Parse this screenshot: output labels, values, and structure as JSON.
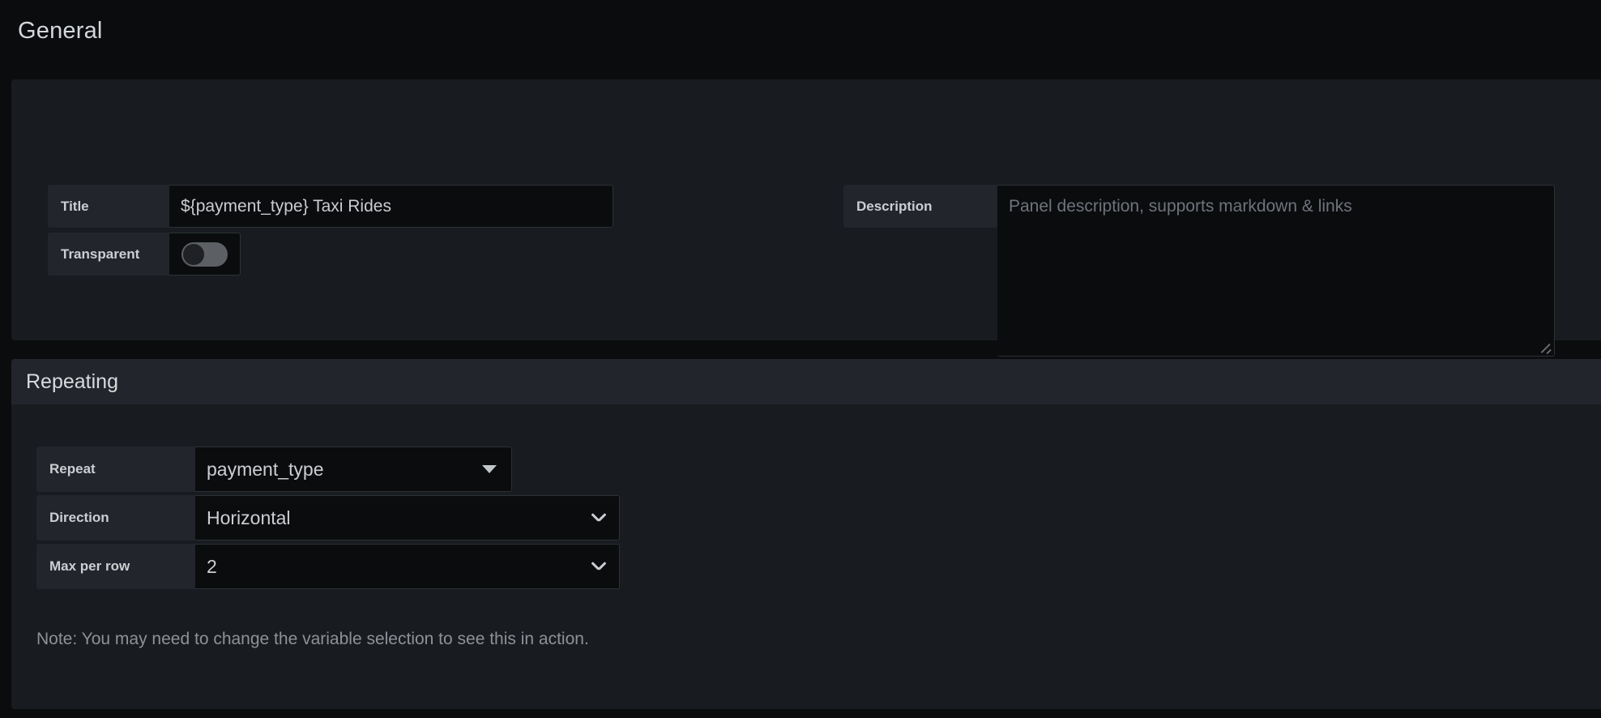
{
  "sections": {
    "general": {
      "heading": "General",
      "title_field": {
        "label": "Title",
        "value": "${payment_type} Taxi Rides"
      },
      "transparent_field": {
        "label": "Transparent",
        "state": "off"
      },
      "description_field": {
        "label": "Description",
        "value": "",
        "placeholder": "Panel description, supports markdown & links"
      }
    },
    "repeating": {
      "heading": "Repeating",
      "repeat_field": {
        "label": "Repeat",
        "value": "payment_type",
        "icon": "caret-down-icon"
      },
      "direction_field": {
        "label": "Direction",
        "value": "Horizontal",
        "icon": "chevron-down-icon"
      },
      "max_per_row_field": {
        "label": "Max per row",
        "value": "2",
        "icon": "chevron-down-icon"
      },
      "note": "Note: You may need to change the variable selection to see this in action."
    }
  },
  "colors": {
    "page_background": "#0b0c0e",
    "card_background": "#181b1f",
    "header_background": "#22252b",
    "input_background": "#0b0c0e",
    "border": "#2c3235",
    "text_primary": "#ccced2",
    "text_muted": "#8e9297",
    "placeholder": "#6e747b",
    "toggle_track": "#5c5f63",
    "toggle_knob": "#1f2124"
  }
}
